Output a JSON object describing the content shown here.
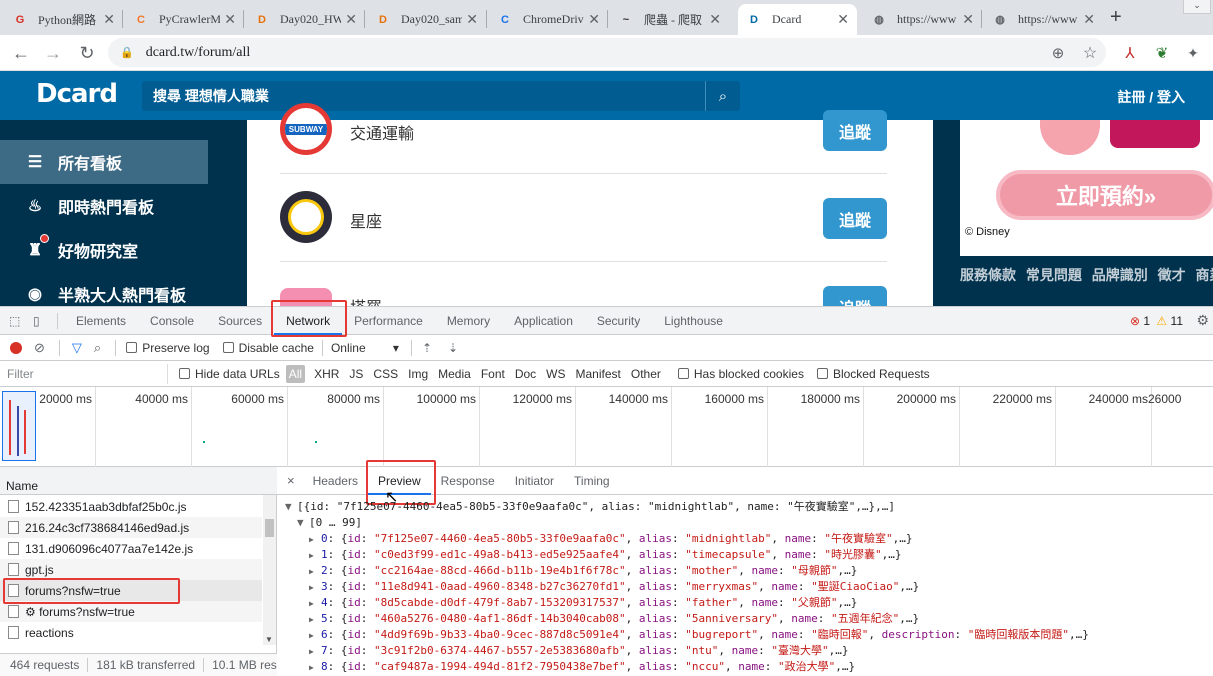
{
  "browser": {
    "tabs": [
      {
        "icon": "G",
        "icon_color": "#d93025",
        "title": "Python網路"
      },
      {
        "icon": "C",
        "icon_color": "#f37626",
        "title": "PyCrawlerM"
      },
      {
        "icon": "D",
        "icon_color": "#e8710a",
        "title": "Day020_HW"
      },
      {
        "icon": "D",
        "icon_color": "#e8710a",
        "title": "Day020_sam"
      },
      {
        "icon": "C",
        "icon_color": "#1a73e8",
        "title": "ChromeDriv"
      },
      {
        "icon": "~",
        "icon_color": "#333333",
        "title": "爬蟲 - 爬取"
      },
      {
        "icon": "D",
        "icon_color": "#006aa6",
        "title": "Dcard"
      },
      {
        "icon": "◍",
        "icon_color": "#5f6368",
        "title": "https://www"
      },
      {
        "icon": "◍",
        "icon_color": "#5f6368",
        "title": "https://www"
      }
    ],
    "close_glyph": "✕",
    "new_tab": "+",
    "url": "dcard.tw/forum/all"
  },
  "site": {
    "logo": "Dcard",
    "search_text": "搜尋 理想情人職業",
    "login": "註冊 / 登入",
    "sidebar": [
      {
        "icon": "☰",
        "label": "所有看板"
      },
      {
        "icon": "♨",
        "label": "即時熱門看板"
      },
      {
        "icon": "♜",
        "label": "好物研究室"
      },
      {
        "icon": "◉",
        "label": "半熟大人熱門看板"
      }
    ],
    "boards": [
      {
        "name": "交通運輸",
        "badge": "SUBWAY",
        "follow": "追蹤"
      },
      {
        "name": "星座",
        "follow": "追蹤"
      },
      {
        "name": "塔羅",
        "follow": "追蹤"
      }
    ],
    "ad": {
      "button": "立即預約»",
      "copyright": "© Disney"
    },
    "footer_links": "服務條款 常見問題 品牌識別 徵才 商業"
  },
  "devtools": {
    "tabs": [
      "Elements",
      "Console",
      "Sources",
      "Network",
      "Performance",
      "Memory",
      "Application",
      "Security",
      "Lighthouse"
    ],
    "errors": "1",
    "warnings": "11",
    "toolbar": {
      "preserve_log": "Preserve log",
      "disable_cache": "Disable cache",
      "throttle": "Online"
    },
    "filter": {
      "placeholder": "Filter",
      "hide_data_urls": "Hide data URLs",
      "types": [
        "All",
        "XHR",
        "JS",
        "CSS",
        "Img",
        "Media",
        "Font",
        "Doc",
        "WS",
        "Manifest",
        "Other"
      ],
      "has_blocked_cookies": "Has blocked cookies",
      "blocked_requests": "Blocked Requests"
    },
    "timeline_ticks": [
      "20000 ms",
      "40000 ms",
      "60000 ms",
      "80000 ms",
      "100000 ms",
      "120000 ms",
      "140000 ms",
      "160000 ms",
      "180000 ms",
      "200000 ms",
      "220000 ms",
      "240000 ms",
      "26000"
    ],
    "requests_header": "Name",
    "requests": [
      "152.423351aab3dbfaf25b0c.js",
      "216.24c3cf738684146ed9ad.js",
      "131.d906096c4077aa7e142e.js",
      "gpt.js",
      "forums?nsfw=true",
      "⚙ forums?nsfw=true",
      "reactions"
    ],
    "status": {
      "requests": "464 requests",
      "transferred": "181 kB transferred",
      "resources": "10.1 MB res"
    },
    "detail_tabs": [
      "Headers",
      "Preview",
      "Response",
      "Initiator",
      "Timing"
    ],
    "preview": {
      "root": "[{id: \"7f125e07-4460-4ea5-80b5-33f0e9aafa0c\", alias: \"midnightlab\", name: \"午夜實驗室\",…},…]",
      "range": "[0 … 99]",
      "items": [
        {
          "idx": "0",
          "id": "\"7f125e07-4460-4ea5-80b5-33f0e9aafa0c\"",
          "alias": "\"midnightlab\"",
          "name": "\"午夜實驗室\"",
          "extra": ""
        },
        {
          "idx": "1",
          "id": "\"c0ed3f99-ed1c-49a8-b413-ed5e925aafe4\"",
          "alias": "\"timecapsule\"",
          "name": "\"時光膠囊\"",
          "extra": ""
        },
        {
          "idx": "2",
          "id": "\"cc2164ae-88cd-466d-b11b-19e4b1f6f78c\"",
          "alias": "\"mother\"",
          "name": "\"母親節\"",
          "extra": ""
        },
        {
          "idx": "3",
          "id": "\"11e8d941-0aad-4960-8348-b27c36270fd1\"",
          "alias": "\"merryxmas\"",
          "name": "\"聖誕CiaoCiao\"",
          "extra": ""
        },
        {
          "idx": "4",
          "id": "\"8d5cabde-d0df-479f-8ab7-153209317537\"",
          "alias": "\"father\"",
          "name": "\"父親節\"",
          "extra": ""
        },
        {
          "idx": "5",
          "id": "\"460a5276-0480-4af1-86df-14b3040cab08\"",
          "alias": "\"5anniversary\"",
          "name": "\"五週年紀念\"",
          "extra": ""
        },
        {
          "idx": "6",
          "id": "\"4dd9f69b-9b33-4ba0-9cec-887d8c5091e4\"",
          "alias": "\"bugreport\"",
          "name": "\"臨時回報\"",
          "extra": "\"臨時回報版本問題\""
        },
        {
          "idx": "7",
          "id": "\"3c91f2b0-6374-4467-b557-2e5383680afb\"",
          "alias": "\"ntu\"",
          "name": "\"臺灣大學\"",
          "extra": ""
        },
        {
          "idx": "8",
          "id": "\"caf9487a-1994-494d-81f2-7950438e7bef\"",
          "alias": "\"nccu\"",
          "name": "\"政治大學\"",
          "extra": ""
        }
      ]
    }
  },
  "colors": {
    "dcard_blue": "#006aa6",
    "sidebar_bg": "#00324e",
    "follow_btn": "#3397cf",
    "highlight_red": "#e53935"
  }
}
